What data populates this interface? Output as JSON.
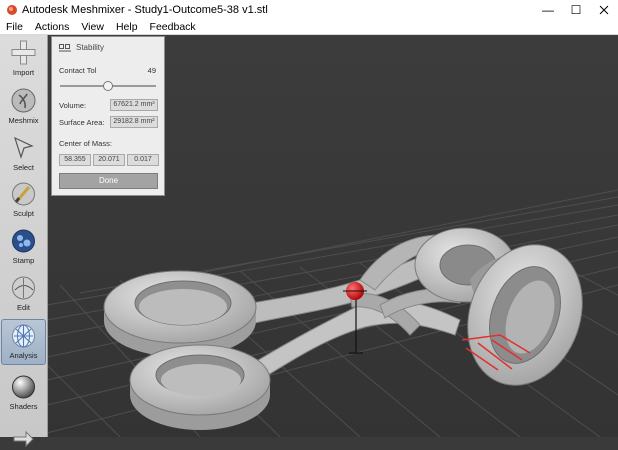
{
  "window": {
    "title": "Autodesk Meshmixer - Study1-Outcome5-38 v1.stl",
    "minimize": "—",
    "maximize": "☐"
  },
  "menu": [
    "File",
    "Actions",
    "View",
    "Help",
    "Feedback"
  ],
  "toolbar": {
    "tools": [
      {
        "label": "Import",
        "icon": "plus-icon"
      },
      {
        "label": "Meshmix",
        "icon": "meshmix-icon"
      },
      {
        "label": "Select",
        "icon": "arrow-cursor-icon"
      },
      {
        "label": "Sculpt",
        "icon": "brush-icon"
      },
      {
        "label": "Stamp",
        "icon": "stamp-icon"
      },
      {
        "label": "Edit",
        "icon": "edit-sphere-icon"
      },
      {
        "label": "Analysis",
        "icon": "analysis-icon"
      },
      {
        "label": "Shaders",
        "icon": "sphere-shader-icon"
      }
    ],
    "active": "Analysis"
  },
  "panel": {
    "title": "Stability",
    "contact_tol_label": "Contact Tol",
    "contact_tol_value": "49",
    "contact_tol_fraction": 0.49,
    "volume_label": "Volume:",
    "volume_value": "67621.2 mm³",
    "surface_area_label": "Surface Area:",
    "surface_area_value": "29182.8 mm²",
    "center_of_mass_label": "Center of Mass:",
    "center_of_mass": [
      "58.355",
      "20.071",
      "0.017"
    ],
    "done_label": "Done"
  },
  "colors": {
    "viewport_bg": "#3a3a3a",
    "grid": "#555555",
    "model": "#c8c8c8",
    "center_of_mass_marker": "#e02020",
    "contact_highlight": "#e03030"
  }
}
